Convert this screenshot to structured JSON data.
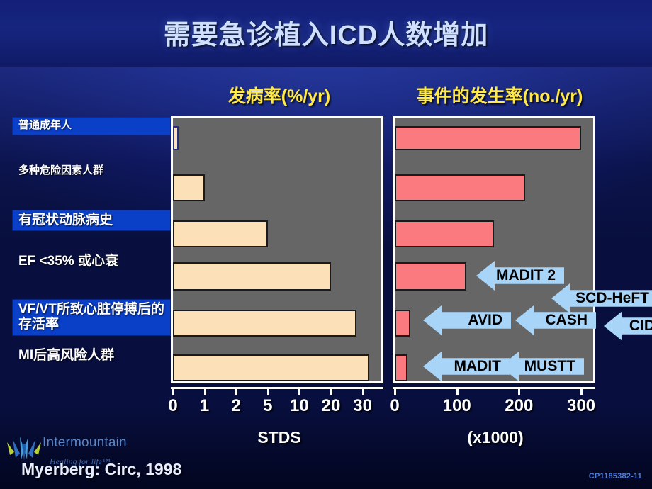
{
  "slide": {
    "title": "需要急诊植入ICD人数增加",
    "citation": "Myerberg:  Circ, 1998",
    "code": "CP1185382-11"
  },
  "logo": {
    "name": "Intermountain",
    "tagline": "Healing for life™"
  },
  "charts": {
    "left": {
      "header": "发病率(%/yr)",
      "axis_title": "STDS",
      "ticks": [
        "0",
        "1",
        "2",
        "5",
        "10",
        "20",
        "30"
      ]
    },
    "right": {
      "header": "事件的发生率(no./yr)",
      "axis_title": "(x1000)",
      "ticks": [
        "0",
        "100",
        "200",
        "300"
      ]
    }
  },
  "rows": [
    {
      "label": "普通成年人",
      "highlight": true,
      "lines": 1
    },
    {
      "label": "多种危险因素人群",
      "highlight": false,
      "lines": 1
    },
    {
      "label": "有冠状动脉病史",
      "highlight": true,
      "lines": 1
    },
    {
      "label": "EF <35% 或心衰",
      "highlight": false,
      "lines": 1
    },
    {
      "label": "VF/VT所致心脏停搏后的\n存活率",
      "highlight": true,
      "lines": 2
    },
    {
      "label": "MI后高风险人群",
      "highlight": false,
      "lines": 1
    }
  ],
  "callouts": [
    {
      "label": "MADIT 2"
    },
    {
      "label": "SCD-HeFT"
    },
    {
      "label": "AVID"
    },
    {
      "label": "CASH"
    },
    {
      "label": "CIDS"
    },
    {
      "label": "MADIT"
    },
    {
      "label": "MUSTT"
    }
  ],
  "colors": {
    "bar_incidence": "#fce0b8",
    "bar_events": "#fa7a80",
    "plot_bg": "#666666",
    "highlight": "#0a3fc8",
    "header_text": "#ffe84a",
    "callout": "#a8d4f8"
  },
  "chart_data": [
    {
      "type": "bar",
      "title": "发病率(%/yr)",
      "xlabel": "STDS",
      "ylabel": "",
      "orientation": "horizontal",
      "scale": "ordinal-log",
      "xticks": [
        0,
        1,
        2,
        5,
        10,
        20,
        30
      ],
      "categories": [
        "普通成年人",
        "多种危险因素人群",
        "有冠状动脉病史",
        "EF <35% 或心衰",
        "VF/VT所致心脏停搏后的存活率",
        "MI后高风险人群"
      ],
      "values": [
        0.1,
        1,
        5,
        20,
        28,
        32
      ],
      "grid": false,
      "legend": "none"
    },
    {
      "type": "bar",
      "title": "事件的发生率(no./yr)",
      "xlabel": "(x1000)",
      "ylabel": "",
      "orientation": "horizontal",
      "xticks": [
        0,
        100,
        200,
        300
      ],
      "xlim": [
        0,
        320
      ],
      "categories": [
        "普通成年人",
        "多种危险因素人群",
        "有冠状动脉病史",
        "EF <35% 或心衰",
        "VF/VT所致心脏停搏后的存活率",
        "MI后高风险人群"
      ],
      "values": [
        300,
        210,
        160,
        115,
        25,
        20
      ],
      "annotations": [
        "MADIT 2",
        "SCD-HeFT",
        "AVID",
        "CASH",
        "CIDS",
        "MADIT",
        "MUSTT"
      ],
      "grid": false,
      "legend": "none"
    }
  ]
}
